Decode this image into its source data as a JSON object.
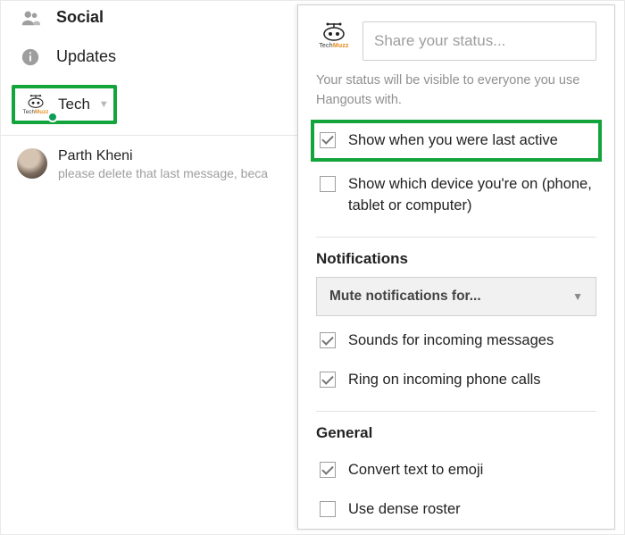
{
  "sidebar": {
    "items": [
      {
        "label": "Social",
        "icon": "people-icon",
        "bold": true
      },
      {
        "label": "Updates",
        "icon": "info-icon",
        "bold": false
      }
    ],
    "account": {
      "name": "Tech",
      "brand_a": "Tech",
      "brand_b": "Muzz"
    },
    "conversation": {
      "name": "Parth Kheni",
      "snippet": "please delete that last message, beca"
    }
  },
  "settings": {
    "brand_a": "Tech",
    "brand_b": "Muzz",
    "status_placeholder": "Share your status...",
    "hint": "Your status will be visible to everyone you use Hangouts with.",
    "show_last_active": {
      "label": "Show when you were last active",
      "checked": true
    },
    "show_device": {
      "label": "Show which device you're on (phone, tablet or computer)",
      "checked": false
    },
    "notifications": {
      "title": "Notifications",
      "mute_label": "Mute notifications for...",
      "sounds": {
        "label": "Sounds for incoming messages",
        "checked": true
      },
      "ring": {
        "label": "Ring on incoming phone calls",
        "checked": true
      }
    },
    "general": {
      "title": "General",
      "emoji": {
        "label": "Convert text to emoji",
        "checked": true
      },
      "dense": {
        "label": "Use dense roster",
        "checked": false
      }
    }
  }
}
